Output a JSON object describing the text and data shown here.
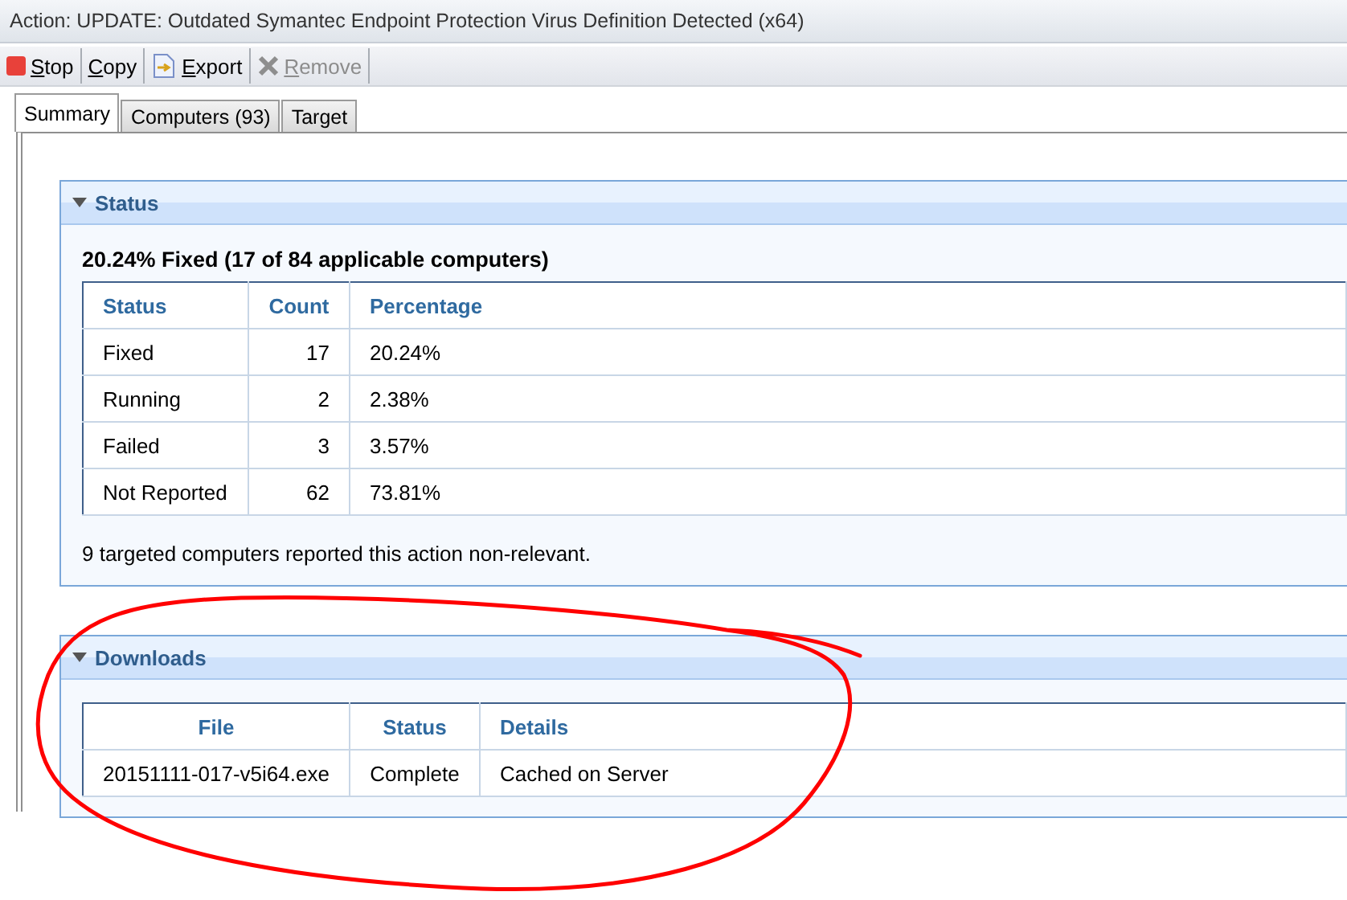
{
  "window": {
    "title": "Action: UPDATE: Outdated Symantec Endpoint Protection Virus Definition Detected (x64)"
  },
  "toolbar": [
    {
      "kind": "stop",
      "label": "Stop",
      "disabled": false
    },
    {
      "kind": "copy",
      "label": "Copy",
      "disabled": false
    },
    {
      "kind": "export",
      "label": "Export",
      "disabled": false
    },
    {
      "kind": "remove",
      "label": "Remove",
      "disabled": true
    }
  ],
  "tabs": [
    {
      "label": "Summary",
      "selected": true
    },
    {
      "label": "Computers (93)",
      "selected": false
    },
    {
      "label": "Target",
      "selected": false
    }
  ],
  "status_section": {
    "title": "Status",
    "expanded": true,
    "summary": "20.24% Fixed (17 of 84 applicable computers)",
    "columns": [
      "Status",
      "Count",
      "Percentage"
    ],
    "rows": [
      [
        "Fixed",
        "17",
        "20.24%"
      ],
      [
        "Running",
        "2",
        "2.38%"
      ],
      [
        "Failed",
        "3",
        "3.57%"
      ],
      [
        "Not Reported",
        "62",
        "73.81%"
      ]
    ],
    "note": "9 targeted computers reported this action non-relevant."
  },
  "downloads_section": {
    "title": "Downloads",
    "expanded": true,
    "columns": [
      "File",
      "Status",
      "Details"
    ],
    "rows": [
      [
        "20151111-017-v5i64.exe",
        "Complete",
        "Cached on Server"
      ]
    ]
  }
}
